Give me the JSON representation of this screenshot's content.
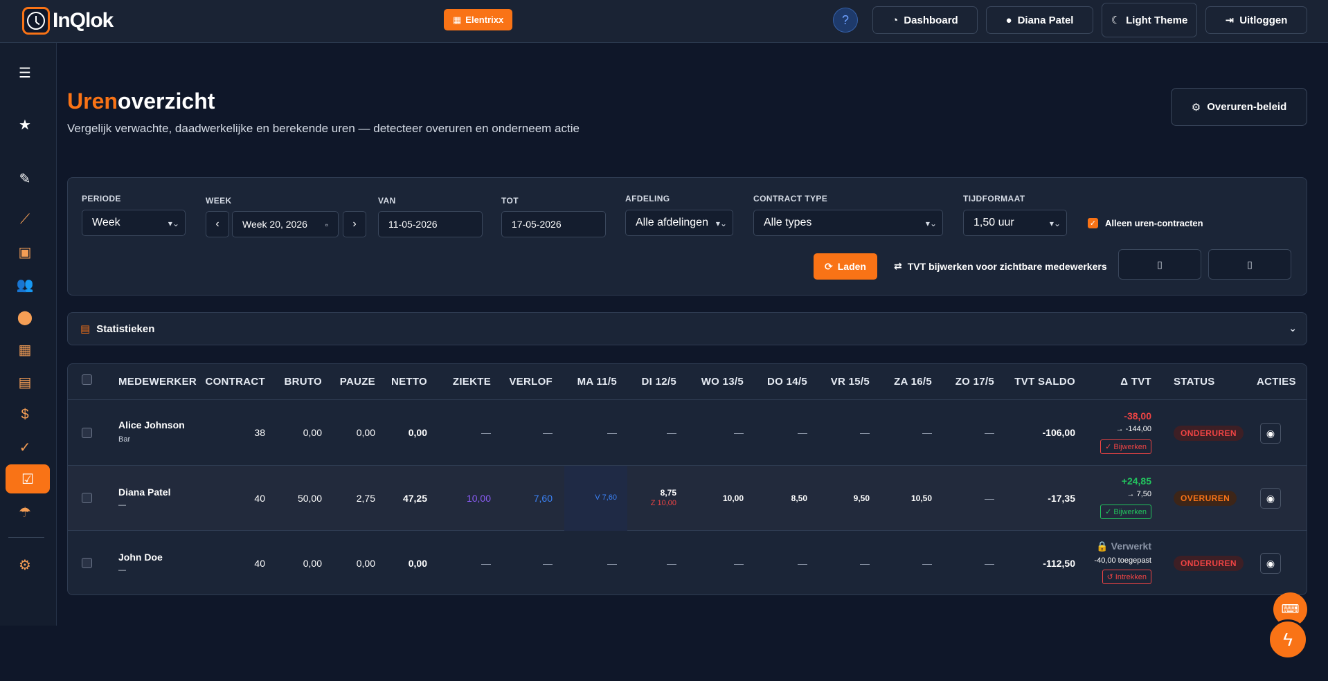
{
  "app": {
    "logo_text": "InQlok",
    "tenant": "Elentrixx"
  },
  "topnav": {
    "help": "?",
    "dashboard": "Dashboard",
    "user": "Diana Patel",
    "theme": "Light Theme",
    "logout": "Uitloggen"
  },
  "page": {
    "title_accent": "Uren",
    "title_rest": "overzicht",
    "subtitle": "Vergelijk verwachte, daadwerkelijke en berekende uren — detecteer overuren en onderneem actie",
    "policy_button": "Overuren-beleid"
  },
  "filters": {
    "periode_label": "PERIODE",
    "periode_value": "Week",
    "week_label": "WEEK",
    "week_value": "Week 20, 2026",
    "van_label": "VAN",
    "van_value": "11-05-2026",
    "tot_label": "TOT",
    "tot_value": "17-05-2026",
    "afdeling_label": "AFDELING",
    "afdeling_value": "Alle afdelingen",
    "contract_label": "CONTRACT TYPE",
    "contract_value": "Alle types",
    "tijd_label": "TIJDFORMAAT",
    "tijd_value": "1,50 uur",
    "only_hours_label": "Alleen uren-contracten",
    "load_button": "Laden",
    "tvt_update": "TVT bijwerken voor zichtbare medewerkers"
  },
  "stats": {
    "label": "Statistieken"
  },
  "table": {
    "headers": [
      "MEDEWERKER",
      "CONTRACT",
      "BRUTO",
      "PAUZE",
      "NETTO",
      "ZIEKTE",
      "VERLOF",
      "MA 11/5",
      "DI 12/5",
      "WO 13/5",
      "DO 14/5",
      "VR 15/5",
      "ZA 16/5",
      "ZO 17/5",
      "TVT SALDO",
      "Δ TVT",
      "STATUS",
      "ACTIES"
    ],
    "rows": [
      {
        "name": "Alice Johnson",
        "sub": "Bar",
        "contract": "38",
        "bruto": "0,00",
        "pauze": "0,00",
        "netto": "0,00",
        "ziekte": "—",
        "verlof": "—",
        "ma": "—",
        "di": "—",
        "di_sub": "",
        "wo": "—",
        "do": "—",
        "vr": "—",
        "za": "—",
        "zo": "—",
        "saldo": "-106,00",
        "delta": "-38,00",
        "delta_sub": "→ -144,00",
        "action": "Bijwerken",
        "status": "ONDERUREN"
      },
      {
        "name": "Diana Patel",
        "sub": "—",
        "contract": "40",
        "bruto": "50,00",
        "pauze": "2,75",
        "netto": "47,25",
        "ziekte": "10,00",
        "verlof": "7,60",
        "ma": "V 7,60",
        "di": "8,75",
        "di_sub": "Z 10,00",
        "wo": "10,00",
        "do": "8,50",
        "vr": "9,50",
        "za": "10,50",
        "zo": "—",
        "saldo": "-17,35",
        "delta": "+24,85",
        "delta_sub": "→ 7,50",
        "action": "Bijwerken",
        "status": "OVERUREN"
      },
      {
        "name": "John Doe",
        "sub": "—",
        "contract": "40",
        "bruto": "0,00",
        "pauze": "0,00",
        "netto": "0,00",
        "ziekte": "—",
        "verlof": "—",
        "ma": "—",
        "di": "—",
        "di_sub": "",
        "wo": "—",
        "do": "—",
        "vr": "—",
        "za": "—",
        "zo": "—",
        "saldo": "-112,50",
        "delta": "Verwerkt",
        "delta_sub": "-40,00 toegepast",
        "action": "Intrekken",
        "status": "ONDERUREN"
      }
    ]
  },
  "colors": {
    "accent": "#f97316",
    "bg": "#0f1729",
    "panel": "#1b2537",
    "danger": "#ef4444",
    "success": "#22c55e",
    "purple": "#8b5cf6",
    "blue": "#3b82f6"
  }
}
